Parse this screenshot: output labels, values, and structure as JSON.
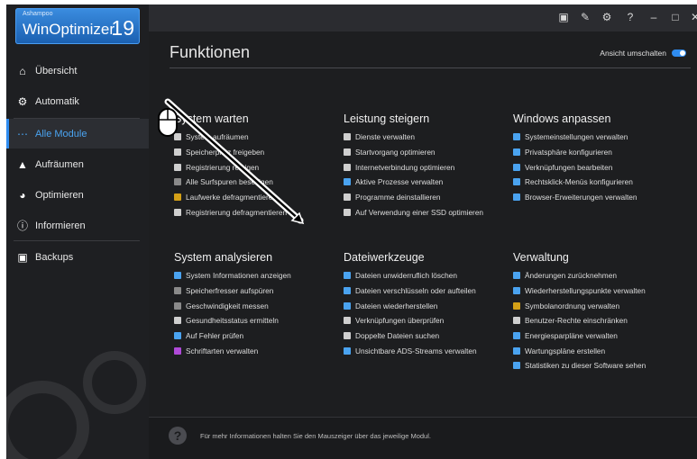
{
  "logo": {
    "brand": "Ashampoo",
    "product": "WinOptimizer",
    "version": "19"
  },
  "sidebar": {
    "items": [
      {
        "label": "Übersicht",
        "icon": "home-icon"
      },
      {
        "label": "Automatik",
        "icon": "automation-icon"
      },
      {
        "label": "Alle Module",
        "icon": "grid-icon",
        "active": true
      },
      {
        "label": "Aufräumen",
        "icon": "broom-icon"
      },
      {
        "label": "Optimieren",
        "icon": "speedometer-icon"
      },
      {
        "label": "Informieren",
        "icon": "info-icon"
      },
      {
        "label": "Backups",
        "icon": "backup-icon"
      }
    ]
  },
  "titlebar": {
    "buttons": [
      {
        "icon": "chat-icon"
      },
      {
        "icon": "edit-icon"
      },
      {
        "icon": "gear-icon"
      },
      {
        "icon": "help-icon",
        "glyph": "?"
      },
      {
        "icon": "minimize-icon"
      },
      {
        "icon": "maximize-icon"
      },
      {
        "icon": "close-icon"
      }
    ]
  },
  "main": {
    "title": "Funktionen",
    "view_toggle_label": "Ansicht umschalten",
    "groups": [
      {
        "title": "System warten",
        "items": [
          {
            "label": "System aufräumen",
            "icon": "disk-icon",
            "color": "#cfcfcf"
          },
          {
            "label": "Speicherplatz freigeben",
            "icon": "file-icon",
            "color": "#cfcfcf"
          },
          {
            "label": "Registrierung reinigen",
            "icon": "registry-icon",
            "color": "#cfcfcf"
          },
          {
            "label": "Alle Surfspuren beseitigen",
            "icon": "globe-icon",
            "color": "#8a8a8a"
          },
          {
            "label": "Laufwerke defragmentieren",
            "icon": "defrag-icon",
            "color": "#d4a017"
          },
          {
            "label": "Registrierung defragmentieren",
            "icon": "registry-icon",
            "color": "#cfcfcf"
          }
        ]
      },
      {
        "title": "Leistung steigern",
        "items": [
          {
            "label": "Dienste verwalten",
            "icon": "services-icon",
            "color": "#cfcfcf"
          },
          {
            "label": "Startvorgang optimieren",
            "icon": "rocket-icon",
            "color": "#cfcfcf"
          },
          {
            "label": "Internetverbindung optimieren",
            "icon": "network-icon",
            "color": "#cfcfcf"
          },
          {
            "label": "Aktive Prozesse verwalten",
            "icon": "process-icon",
            "color": "#4aa3f0"
          },
          {
            "label": "Programme deinstallieren",
            "icon": "monitor-icon",
            "color": "#cfcfcf"
          },
          {
            "label": "Auf Verwendung einer SSD optimieren",
            "icon": "ssd-icon",
            "color": "#cfcfcf"
          }
        ]
      },
      {
        "title": "Windows anpassen",
        "items": [
          {
            "label": "Systemeinstellungen verwalten",
            "icon": "settings-icon",
            "color": "#4aa3f0"
          },
          {
            "label": "Privatsphäre konfigurieren",
            "icon": "privacy-icon",
            "color": "#4aa3f0"
          },
          {
            "label": "Verknüpfungen bearbeiten",
            "icon": "shortcut-icon",
            "color": "#4aa3f0"
          },
          {
            "label": "Rechtsklick-Menüs konfigurieren",
            "icon": "context-menu-icon",
            "color": "#4aa3f0"
          },
          {
            "label": "Browser-Erweiterungen verwalten",
            "icon": "puzzle-icon",
            "color": "#4aa3f0"
          }
        ]
      },
      {
        "title": "System analysieren",
        "items": [
          {
            "label": "System Informationen anzeigen",
            "icon": "system-info-icon",
            "color": "#4aa3f0"
          },
          {
            "label": "Speicherfresser aufspüren",
            "icon": "storage-icon",
            "color": "#8a8a8a"
          },
          {
            "label": "Geschwindigkeit messen",
            "icon": "gauge-icon",
            "color": "#8a8a8a"
          },
          {
            "label": "Gesundheitsstatus ermitteln",
            "icon": "health-icon",
            "color": "#cfcfcf"
          },
          {
            "label": "Auf Fehler prüfen",
            "icon": "drive-check-icon",
            "color": "#4aa3f0"
          },
          {
            "label": "Schriftarten verwalten",
            "icon": "font-icon",
            "color": "#b04ad8"
          }
        ]
      },
      {
        "title": "Dateiwerkzeuge",
        "items": [
          {
            "label": "Dateien unwiderruflich löschen",
            "icon": "shredder-icon",
            "color": "#4aa3f0"
          },
          {
            "label": "Dateien verschlüsseln oder aufteilen",
            "icon": "lock-file-icon",
            "color": "#4aa3f0"
          },
          {
            "label": "Dateien wiederherstellen",
            "icon": "restore-file-icon",
            "color": "#4aa3f0"
          },
          {
            "label": "Verknüpfungen überprüfen",
            "icon": "link-icon",
            "color": "#cfcfcf"
          },
          {
            "label": "Doppelte Dateien suchen",
            "icon": "duplicate-icon",
            "color": "#cfcfcf"
          },
          {
            "label": "Unsichtbare ADS-Streams verwalten",
            "icon": "stream-icon",
            "color": "#4aa3f0"
          }
        ]
      },
      {
        "title": "Verwaltung",
        "items": [
          {
            "label": "Änderungen zurücknehmen",
            "icon": "undo-icon",
            "color": "#4aa3f0"
          },
          {
            "label": "Wiederherstellungspunkte verwalten",
            "icon": "restore-point-icon",
            "color": "#4aa3f0"
          },
          {
            "label": "Symbolanordnung verwalten",
            "icon": "icons-layout-icon",
            "color": "#d4a017"
          },
          {
            "label": "Benutzer-Rechte einschränken",
            "icon": "user-icon",
            "color": "#cfcfcf"
          },
          {
            "label": "Energiesparpläne verwalten",
            "icon": "energy-icon",
            "color": "#4aa3f0"
          },
          {
            "label": "Wartungspläne erstellen",
            "icon": "calendar-icon",
            "color": "#4aa3f0"
          },
          {
            "label": "Statistiken zu dieser Software sehen",
            "icon": "stats-icon",
            "color": "#4aa3f0"
          }
        ]
      }
    ]
  },
  "footer": {
    "text": "Für mehr Informationen halten Sie den Mauszeiger über das jeweilige Modul."
  }
}
